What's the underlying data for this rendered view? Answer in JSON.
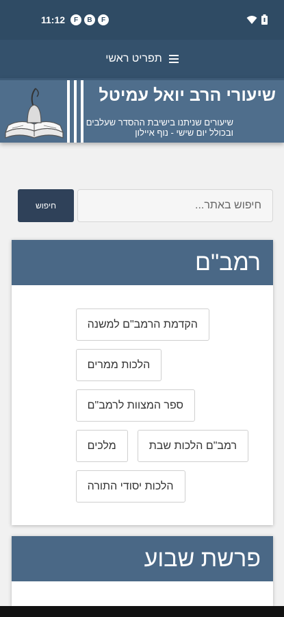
{
  "status_bar": {
    "time": "11:12",
    "notification_icons": [
      "F",
      "B",
      "F"
    ],
    "icons": [
      "wifi-icon",
      "battery-icon"
    ]
  },
  "nav": {
    "menu_label": "תפריט ראשי",
    "menu_icon": "hamburger-icon"
  },
  "banner": {
    "title": "שיעורי הרב יואל עמיטל",
    "subtitle_line1": "שיעורים שניתנו בישיבת ההסדר שעלבים",
    "subtitle_line2": "ובכולל יום שישי - נוף איילון",
    "logo_icon": "book-scroll-logo"
  },
  "search": {
    "placeholder": "חיפוש באתר...",
    "button_label": "חיפוש"
  },
  "sections": [
    {
      "title": "רמב\"ם",
      "topics": [
        [
          "הקדמת הרמב\"ם למשנה"
        ],
        [
          "הלכות ממרים"
        ],
        [
          "ספר המצוות לרמב\"ם"
        ],
        [
          "רמב\"ם הלכות שבת",
          "מלכים"
        ],
        [
          "הלכות יסודי התורה"
        ]
      ]
    },
    {
      "title": "פרשת שבוע"
    }
  ],
  "colors": {
    "status_bar": "#2f4b64",
    "nav_bar": "#34516c",
    "card_header": "#4a6886",
    "search_button": "#2f4159"
  }
}
